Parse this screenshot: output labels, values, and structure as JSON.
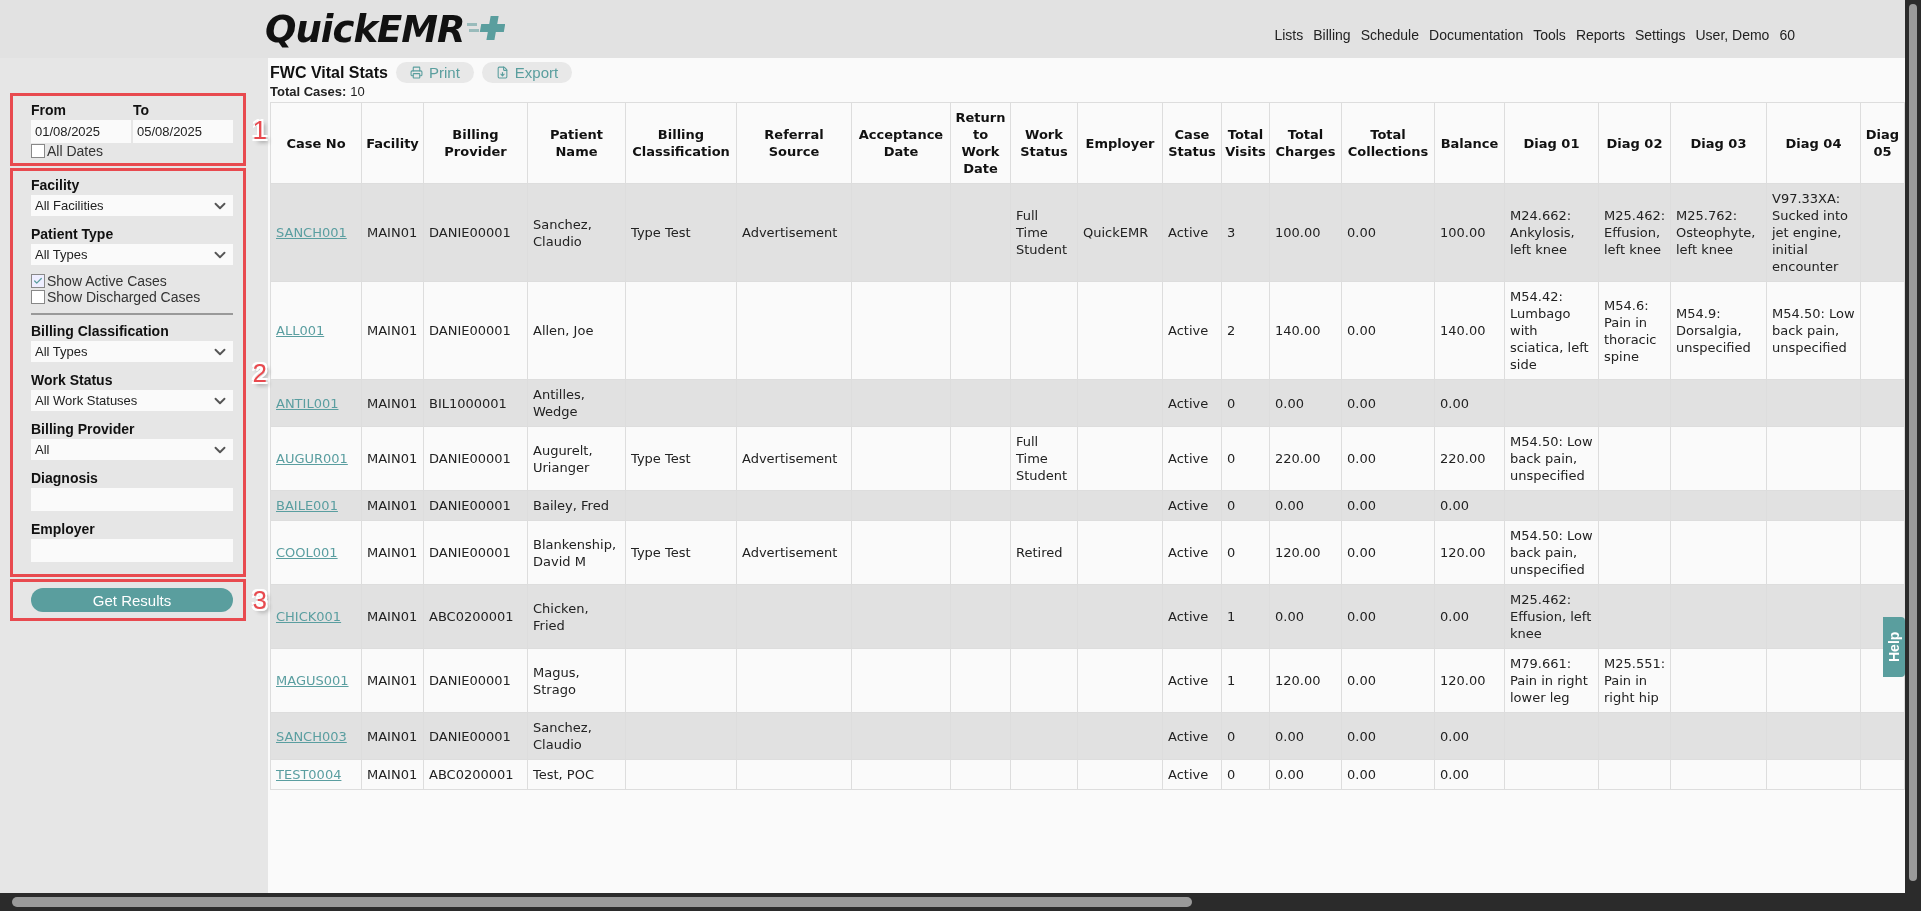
{
  "header": {
    "logo": "QuickEMR",
    "nav": [
      "Lists",
      "Billing",
      "Schedule",
      "Documentation",
      "Tools",
      "Reports",
      "Settings",
      "User, Demo",
      "60"
    ]
  },
  "filters": [
    {
      "number": "1",
      "items": [
        {
          "kind": "date_pair",
          "from": {
            "label": "From",
            "value": "01/08/2025"
          },
          "to": {
            "label": "To",
            "value": "05/08/2025"
          }
        },
        {
          "kind": "checkbox",
          "label": "All Dates",
          "checked": false
        }
      ]
    },
    {
      "number": "2",
      "items": [
        {
          "kind": "select",
          "label": "Facility",
          "value": "All Facilities"
        },
        {
          "kind": "select",
          "label": "Patient Type",
          "value": "All Types"
        },
        {
          "kind": "checkbox",
          "label": "Show Active Cases",
          "checked": true
        },
        {
          "kind": "checkbox",
          "label": "Show Discharged Cases",
          "checked": false
        },
        {
          "kind": "divider"
        },
        {
          "kind": "select",
          "label": "Billing Classification",
          "value": "All Types"
        },
        {
          "kind": "select",
          "label": "Work Status",
          "value": "All Work Statuses"
        },
        {
          "kind": "select",
          "label": "Billing Provider",
          "value": "All"
        },
        {
          "kind": "text",
          "label": "Diagnosis"
        },
        {
          "kind": "text",
          "label": "Employer"
        }
      ]
    },
    {
      "number": "3",
      "items": [
        {
          "kind": "button",
          "label": "Get Results"
        }
      ]
    }
  ],
  "report": {
    "title": "FWC Vital Stats",
    "actions": [
      {
        "kind": "print",
        "label": "Print"
      },
      {
        "kind": "export",
        "label": "Export"
      }
    ],
    "total_label": "Total Cases:",
    "total_value": "10"
  },
  "table": {
    "columns": [
      "Case No",
      "Facility",
      "Billing Provider",
      "Patient Name",
      "Billing Classification",
      "Referral Source",
      "Acceptance Date",
      "Return to Work Date",
      "Work Status",
      "Employer",
      "Case Status",
      "Total Visits",
      "Total Charges",
      "Total Collections",
      "Balance",
      "Diag 01",
      "Diag 02",
      "Diag 03",
      "Diag 04",
      "Diag 05"
    ],
    "rows": [
      [
        "SANCH001",
        "MAIN01",
        "DANIE00001",
        "Sanchez, Claudio",
        "Type Test",
        "Advertisement",
        null,
        null,
        "Full Time Student",
        "QuickEMR",
        "Active",
        "3",
        "100.00",
        "0.00",
        "100.00",
        "M24.662: Ankylosis, left knee",
        "M25.462: Effusion, left knee",
        "M25.762: Osteophyte, left knee",
        "V97.33XA: Sucked into jet engine, initial encounter",
        null
      ],
      [
        "ALL001",
        "MAIN01",
        "DANIE00001",
        "Allen, Joe",
        null,
        null,
        null,
        null,
        null,
        null,
        "Active",
        "2",
        "140.00",
        "0.00",
        "140.00",
        "M54.42: Lumbago with sciatica, left side",
        "M54.6: Pain in thoracic spine",
        "M54.9: Dorsalgia, unspecified",
        "M54.50: Low back pain, unspecified",
        null
      ],
      [
        "ANTIL001",
        "MAIN01",
        "BIL1000001",
        "Antilles, Wedge",
        null,
        null,
        null,
        null,
        null,
        null,
        "Active",
        "0",
        "0.00",
        "0.00",
        "0.00",
        null,
        null,
        null,
        null,
        null
      ],
      [
        "AUGUR001",
        "MAIN01",
        "DANIE00001",
        "Augurelt, Urianger",
        "Type Test",
        "Advertisement",
        null,
        null,
        "Full Time Student",
        null,
        "Active",
        "0",
        "220.00",
        "0.00",
        "220.00",
        "M54.50: Low back pain, unspecified",
        null,
        null,
        null,
        null
      ],
      [
        "BAILE001",
        "MAIN01",
        "DANIE00001",
        "Bailey, Fred",
        null,
        null,
        null,
        null,
        null,
        null,
        "Active",
        "0",
        "0.00",
        "0.00",
        "0.00",
        null,
        null,
        null,
        null,
        null
      ],
      [
        "COOL001",
        "MAIN01",
        "DANIE00001",
        "Blankenship, David M",
        "Type Test",
        "Advertisement",
        null,
        null,
        "Retired",
        null,
        "Active",
        "0",
        "120.00",
        "0.00",
        "120.00",
        "M54.50: Low back pain, unspecified",
        null,
        null,
        null,
        null
      ],
      [
        "CHICK001",
        "MAIN01",
        "ABC0200001",
        "Chicken, Fried",
        null,
        null,
        null,
        null,
        null,
        null,
        "Active",
        "1",
        "0.00",
        "0.00",
        "0.00",
        "M25.462: Effusion, left knee",
        null,
        null,
        null,
        null
      ],
      [
        "MAGUS001",
        "MAIN01",
        "DANIE00001",
        "Magus, Strago",
        null,
        null,
        null,
        null,
        null,
        null,
        "Active",
        "1",
        "120.00",
        "0.00",
        "120.00",
        "M79.661: Pain in right lower leg",
        "M25.551: Pain in right hip",
        null,
        null,
        null
      ],
      [
        "SANCH003",
        "MAIN01",
        "DANIE00001",
        "Sanchez, Claudio",
        null,
        null,
        null,
        null,
        null,
        null,
        "Active",
        "0",
        "0.00",
        "0.00",
        "0.00",
        null,
        null,
        null,
        null,
        null
      ],
      [
        "TEST0004",
        "MAIN01",
        "ABC0200001",
        "Test, POC",
        null,
        null,
        null,
        null,
        null,
        null,
        "Active",
        "0",
        "0.00",
        "0.00",
        "0.00",
        null,
        null,
        null,
        null,
        null
      ]
    ]
  },
  "help_tab": "Help"
}
